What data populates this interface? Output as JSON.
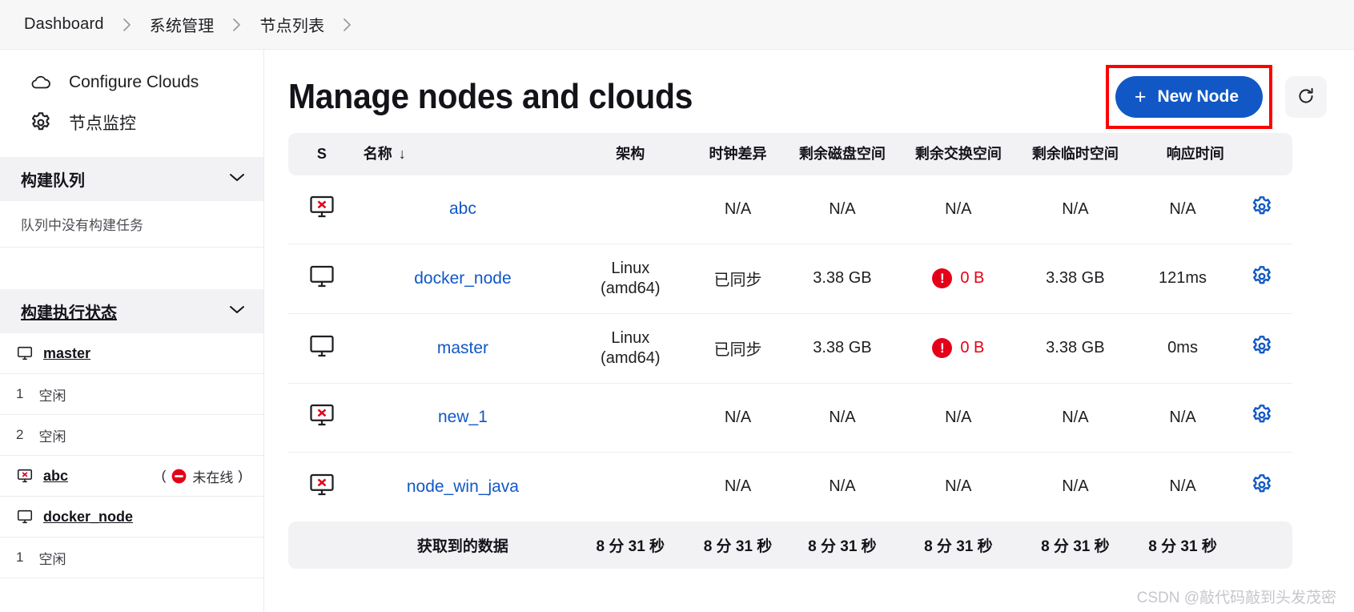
{
  "breadcrumb": {
    "items": [
      {
        "label": "Dashboard"
      },
      {
        "label": "系统管理"
      },
      {
        "label": "节点列表"
      }
    ],
    "separator_icon": "chevron-right-icon"
  },
  "sidebar": {
    "links": [
      {
        "label": "Configure Clouds",
        "icon": "cloud-icon"
      },
      {
        "label": "节点监控",
        "icon": "gear-icon"
      }
    ],
    "build_queue": {
      "title": "构建队列",
      "chevron_icon": "chevron-down-icon",
      "empty_text": "队列中没有构建任务"
    },
    "build_executor": {
      "title": "构建执行状态",
      "chevron_icon": "chevron-down-icon",
      "rows": [
        {
          "type": "node",
          "icon": "monitor-icon",
          "name": "master",
          "status": ""
        },
        {
          "type": "executor",
          "num": "1",
          "state": "空闲"
        },
        {
          "type": "executor",
          "num": "2",
          "state": "空闲"
        },
        {
          "type": "node",
          "icon": "monitor-offline-icon",
          "name": "abc",
          "status": "(⛔ 未在线)",
          "status_text": "未在线"
        },
        {
          "type": "node",
          "icon": "monitor-icon",
          "name": "docker_node",
          "status": ""
        },
        {
          "type": "executor",
          "num": "1",
          "state": "空闲"
        }
      ]
    }
  },
  "main": {
    "title": "Manage nodes and clouds",
    "new_node_button": {
      "label": "New Node",
      "icon": "plus-icon",
      "color": "#1158c6"
    },
    "refresh_button": {
      "icon": "refresh-icon"
    },
    "highlight_color": "#ff0000"
  },
  "table": {
    "headers": {
      "status": "S",
      "name": "名称",
      "name_sort": "↓",
      "arch": "架构",
      "clock": "时钟差异",
      "disk": "剩余磁盘空间",
      "swap": "剩余交换空间",
      "tmp": "剩余临时空间",
      "response": "响应时间",
      "config": ""
    },
    "rows": [
      {
        "icon": "monitor-offline-icon",
        "name": "abc",
        "arch": "",
        "arch_sub": "",
        "clock": "N/A",
        "disk": "N/A",
        "swap": "N/A",
        "swap_warn": false,
        "tmp": "N/A",
        "response": "N/A",
        "config_icon": "gear-icon"
      },
      {
        "icon": "monitor-icon",
        "name": "docker_node",
        "arch": "Linux",
        "arch_sub": "(amd64)",
        "clock": "已同步",
        "disk": "3.38 GB",
        "swap": "0 B",
        "swap_warn": true,
        "tmp": "3.38 GB",
        "response": "121ms",
        "config_icon": "gear-icon"
      },
      {
        "icon": "monitor-icon",
        "name": "master",
        "arch": "Linux",
        "arch_sub": "(amd64)",
        "clock": "已同步",
        "disk": "3.38 GB",
        "swap": "0 B",
        "swap_warn": true,
        "tmp": "3.38 GB",
        "response": "0ms",
        "config_icon": "gear-icon"
      },
      {
        "icon": "monitor-offline-icon",
        "name": "new_1",
        "arch": "",
        "arch_sub": "",
        "clock": "N/A",
        "disk": "N/A",
        "swap": "N/A",
        "swap_warn": false,
        "tmp": "N/A",
        "response": "N/A",
        "config_icon": "gear-icon"
      },
      {
        "icon": "monitor-offline-icon",
        "name": "node_win_java",
        "arch": "",
        "arch_sub": "",
        "clock": "N/A",
        "disk": "N/A",
        "swap": "N/A",
        "swap_warn": false,
        "tmp": "N/A",
        "response": "N/A",
        "config_icon": "gear-icon"
      }
    ],
    "footer": {
      "label": "获取到的数据",
      "arch": "8 分 31 秒",
      "clock": "8 分 31 秒",
      "disk": "8 分 31 秒",
      "swap": "8 分 31 秒",
      "tmp": "8 分 31 秒",
      "response": "8 分 31 秒"
    }
  },
  "watermark": "CSDN @敲代码敲到头发茂密"
}
